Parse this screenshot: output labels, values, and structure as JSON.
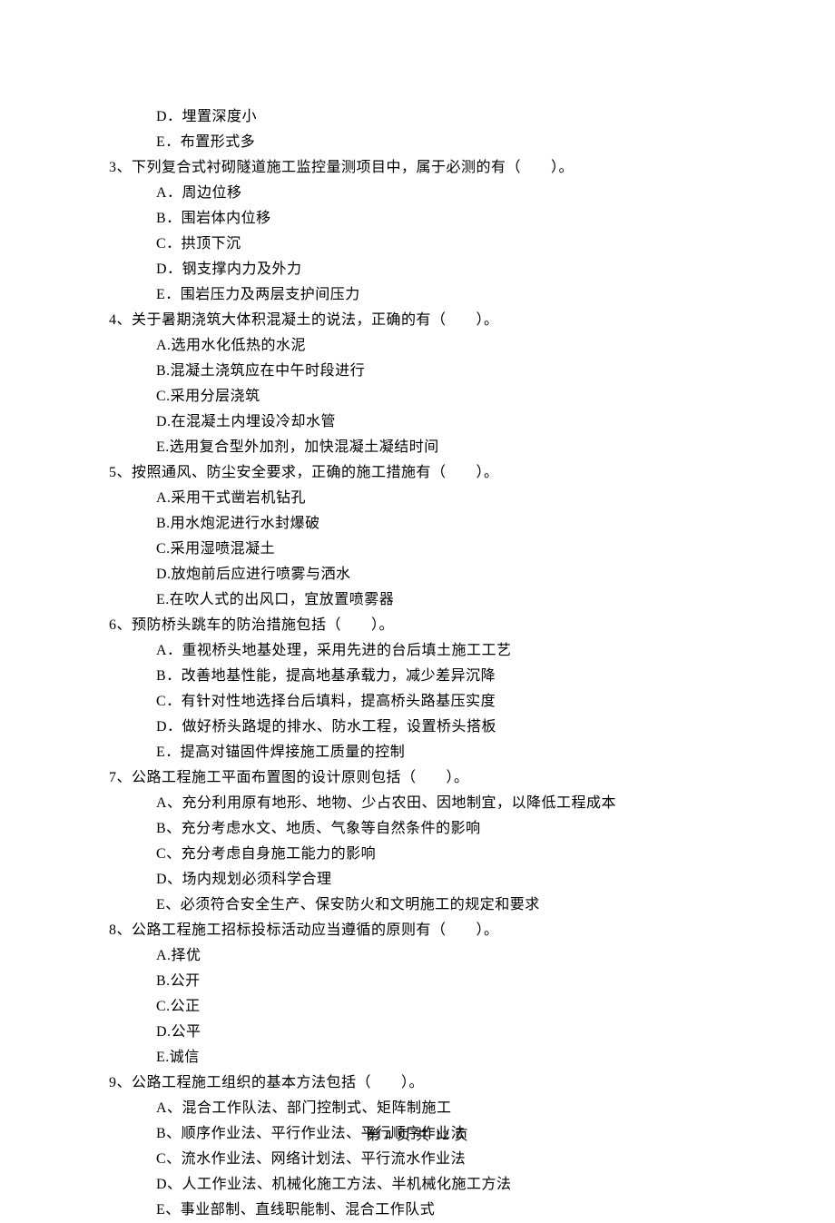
{
  "orphan_options": [
    "D．埋置深度小",
    "E．布置形式多"
  ],
  "questions": [
    {
      "num": "3、",
      "text": "下列复合式衬砌隧道施工监控量测项目中，属于必测的有（　　）。",
      "options": [
        "A．周边位移",
        "B．围岩体内位移",
        "C．拱顶下沉",
        "D．钢支撑内力及外力",
        "E．围岩压力及两层支护间压力"
      ]
    },
    {
      "num": "4、",
      "text": "关于暑期浇筑大体积混凝土的说法，正确的有（　　）。",
      "options": [
        "A.选用水化低热的水泥",
        "B.混凝土浇筑应在中午时段进行",
        "C.采用分层浇筑",
        "D.在混凝土内埋设冷却水管",
        "E.选用复合型外加剂，加快混凝土凝结时间"
      ]
    },
    {
      "num": "5、",
      "text": "按照通风、防尘安全要求，正确的施工措施有（　　）。",
      "options": [
        "A.采用干式凿岩机钻孔",
        "B.用水炮泥进行水封爆破",
        "C.采用湿喷混凝土",
        "D.放炮前后应进行喷雾与洒水",
        "E.在吹人式的出风口，宜放置喷雾器"
      ]
    },
    {
      "num": "6、",
      "text": "预防桥头跳车的防治措施包括（　　）。",
      "options": [
        "A．重视桥头地基处理，采用先进的台后填土施工工艺",
        "B．改善地基性能，提高地基承载力，减少差异沉降",
        "C．有针对性地选择台后填料，提高桥头路基压实度",
        "D．做好桥头路堤的排水、防水工程，设置桥头搭板",
        "E．提高对锚固件焊接施工质量的控制"
      ]
    },
    {
      "num": "7、",
      "text": "公路工程施工平面布置图的设计原则包括（　　）。",
      "options": [
        "A、充分利用原有地形、地物、少占农田、因地制宜，以降低工程成本",
        "B、充分考虑水文、地质、气象等自然条件的影响",
        "C、充分考虑自身施工能力的影响",
        "D、场内规划必须科学合理",
        "E、必须符合安全生产、保安防火和文明施工的规定和要求"
      ]
    },
    {
      "num": "8、",
      "text": "公路工程施工招标投标活动应当遵循的原则有（　　）。",
      "options": [
        "A.择优",
        "B.公开",
        "C.公正",
        "D.公平",
        "E.诚信"
      ]
    },
    {
      "num": "9、",
      "text": "公路工程施工组织的基本方法包括（　　）。",
      "options": [
        "A、混合工作队法、部门控制式、矩阵制施工",
        "B、顺序作业法、平行作业法、平行顺序作业法",
        "C、流水作业法、网络计划法、平行流水作业法",
        "D、人工作业法、机械化施工方法、半机械化施工方法",
        "E、事业部制、直线职能制、混合工作队式"
      ]
    }
  ],
  "footer": "第 4 页 共 12 页"
}
